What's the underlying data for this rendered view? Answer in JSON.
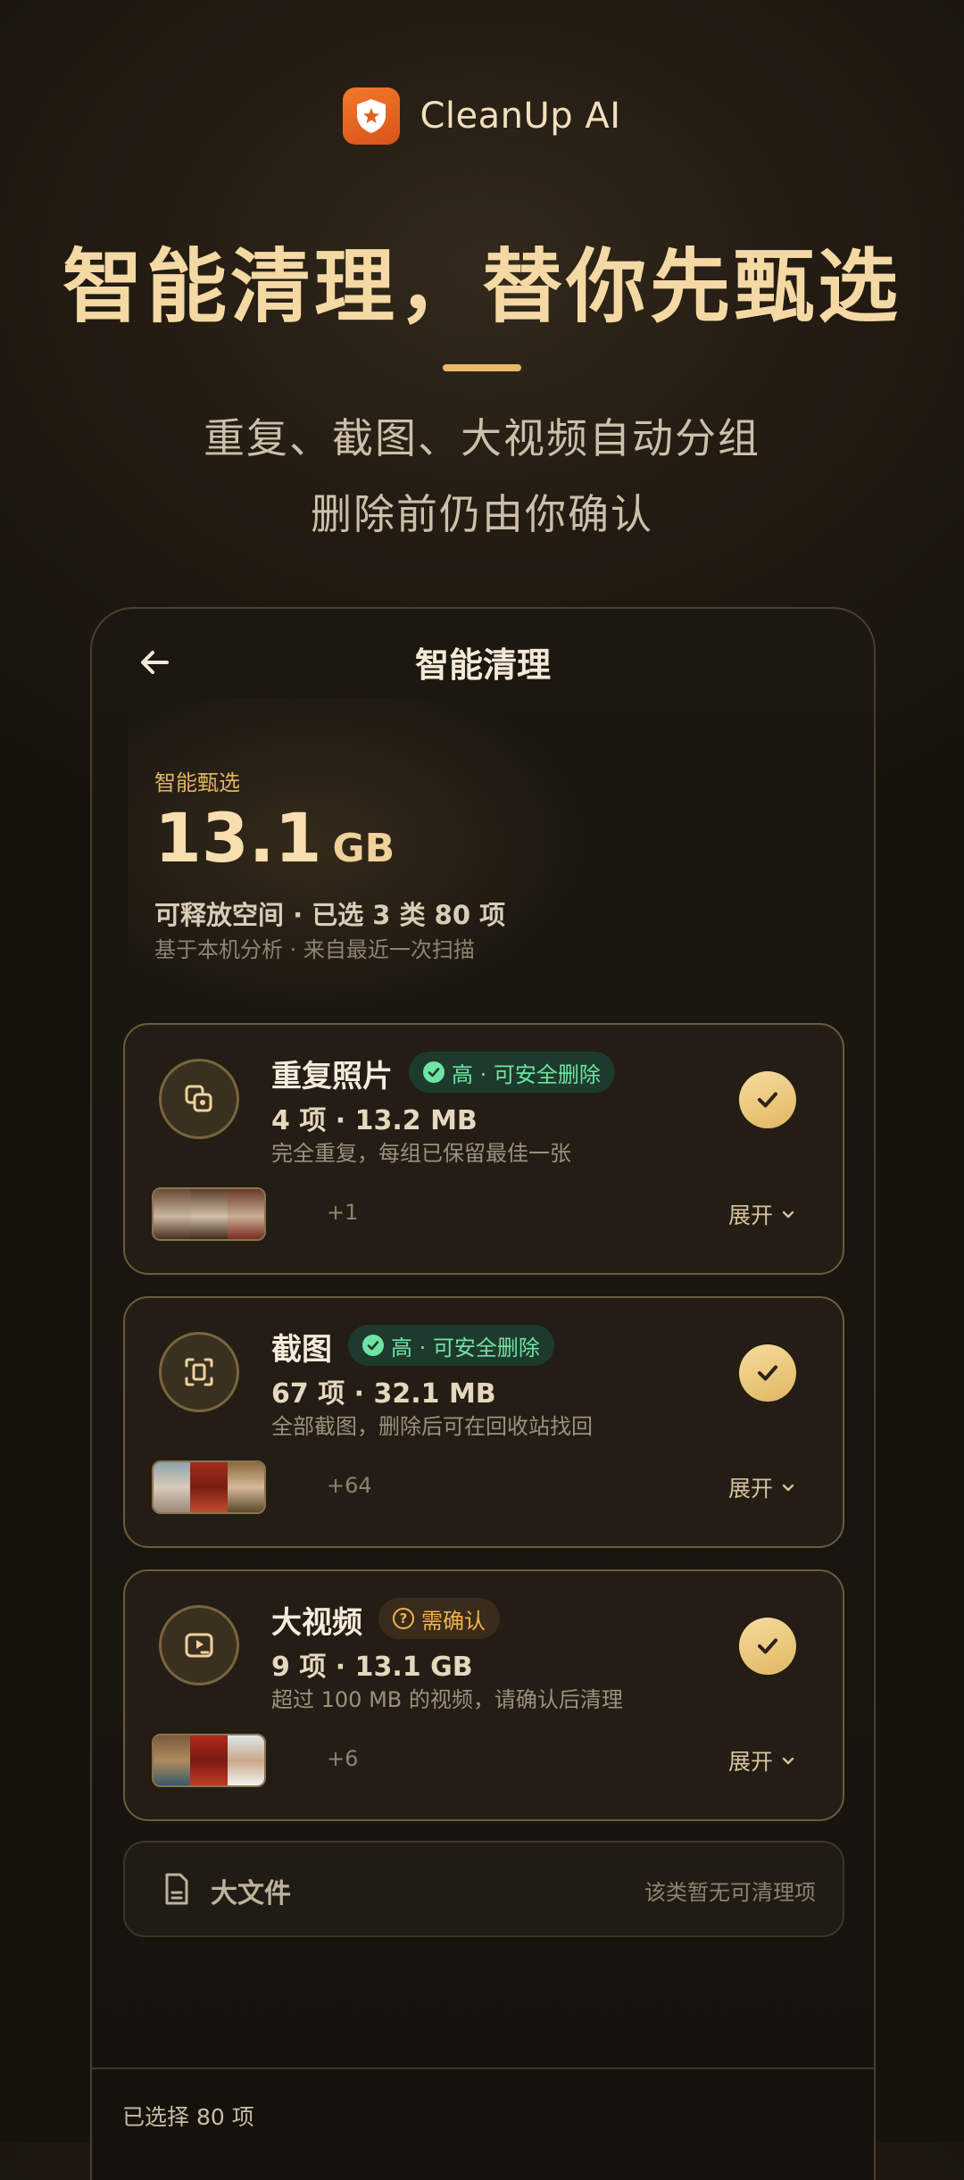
{
  "brand": {
    "name": "CleanUp AI"
  },
  "hero": {
    "title": "智能清理，替你先甄选",
    "subtitle_line1": "重复、截图、大视频自动分组",
    "subtitle_line2": "删除前仍由你确认"
  },
  "screen": {
    "nav_title": "智能清理",
    "summary": {
      "label": "智能甄选",
      "value": "13.1",
      "unit": "GB",
      "desc": "可释放空间 · 已选 3 类 80 项",
      "note": "基于本机分析 · 来自最近一次扫描"
    },
    "cards": [
      {
        "title": "重复照片",
        "badge": "高 · 可安全删除",
        "badge_type": "safe",
        "stats": "4 项 · 13.2 MB",
        "desc": "完全重复，每组已保留最佳一张",
        "more": "+1",
        "expand": "展开",
        "icon": "duplicate-icon",
        "checked": true
      },
      {
        "title": "截图",
        "badge": "高 · 可安全删除",
        "badge_type": "safe",
        "stats": "67 项 · 32.1 MB",
        "desc": "全部截图，删除后可在回收站找回",
        "more": "+64",
        "expand": "展开",
        "icon": "screenshot-icon",
        "checked": true
      },
      {
        "title": "大视频",
        "badge": "需确认",
        "badge_type": "warn",
        "stats": "9 项 · 13.1 GB",
        "desc": "超过 100 MB 的视频，请确认后清理",
        "more": "+6",
        "expand": "展开",
        "icon": "video-icon",
        "checked": true
      }
    ],
    "empty_card": {
      "title": "大文件",
      "note": "该类暂无可清理项",
      "icon": "file-icon"
    },
    "footer": {
      "selected": "已选择 80 项"
    }
  },
  "colors": {
    "accent_gold": "#f5d9a4",
    "safe_green": "#6fe3a4",
    "warn_orange": "#f4b24f",
    "brand_orange": "#f07a2a"
  }
}
